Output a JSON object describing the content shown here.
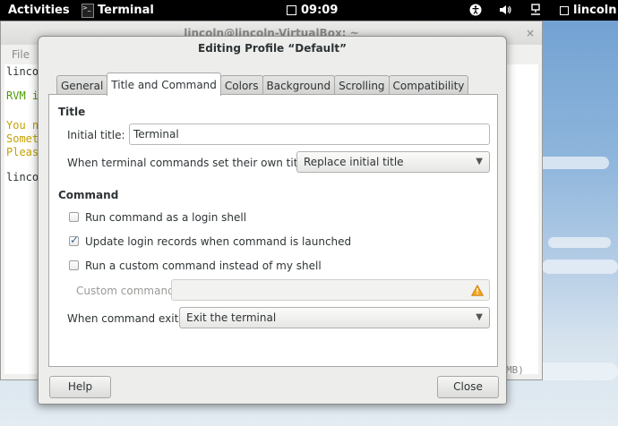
{
  "topbar": {
    "activities": "Activities",
    "app_name": "Terminal",
    "time": "09:09",
    "user": "lincoln"
  },
  "terminal": {
    "title": "lincoln@lincoln-VirtualBox: ~",
    "close_glyph": "×",
    "menu_file": "File",
    "lines": [
      {
        "text": "linco",
        "color": "default"
      },
      {
        "text": "RVM i",
        "color": "green"
      },
      {
        "text": "You n",
        "color": "yellow"
      },
      {
        "text": "Somet",
        "color": "yellow"
      },
      {
        "text": "Pleas",
        "color": "yellow"
      },
      {
        "text": "linco",
        "color": "default"
      }
    ],
    "size_fragment": "MB)"
  },
  "dialog": {
    "title": "Editing Profile “Default”",
    "tabs": [
      "General",
      "Title and Command",
      "Colors",
      "Background",
      "Scrolling",
      "Compatibility"
    ],
    "active_tab": "Title and Command",
    "title_section": {
      "heading": "Title",
      "initial_title_label": "Initial title:",
      "initial_title_value": "Terminal",
      "dynamic_title_label": "When terminal commands set their own titles:",
      "dynamic_title_value": "Replace initial title"
    },
    "command_section": {
      "heading": "Command",
      "login_shell_label": "Run command as a login shell",
      "login_shell_checked": false,
      "update_records_label": "Update login records when command is launched",
      "update_records_checked": true,
      "custom_command_label": "Run a custom command instead of my shell",
      "custom_command_checked": false,
      "custom_command_field_label": "Custom command:",
      "custom_command_value": "",
      "exit_label": "When command exits:",
      "exit_value": "Exit the terminal"
    },
    "help_button": "Help",
    "close_button": "Close"
  },
  "icons": {
    "accessibility": "accessibility-icon",
    "volume": "volume-icon",
    "network": "network-icon",
    "warning": "warning-icon",
    "dropdown": "chevron-down-icon"
  },
  "colors": {
    "term_green": "#4e9a06",
    "term_yellow": "#c4a000",
    "checkbox_mark": "#3465a4"
  }
}
